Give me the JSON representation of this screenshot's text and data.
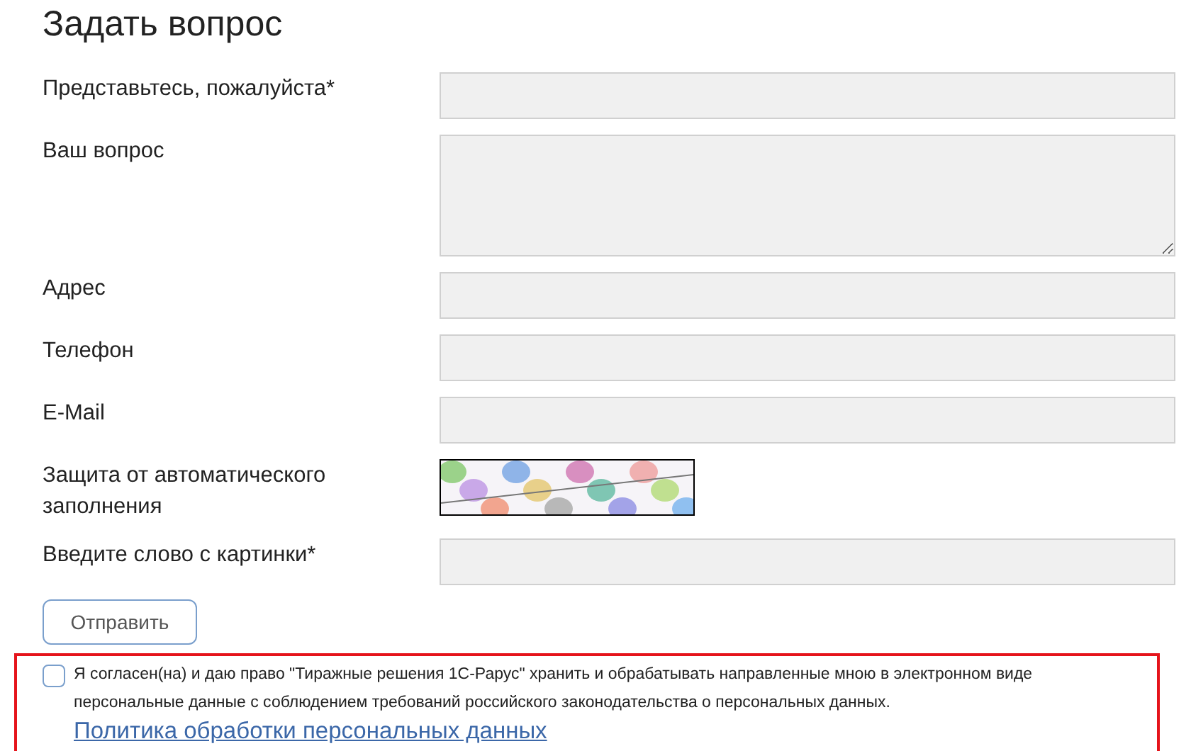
{
  "title": "Задать вопрос",
  "fields": [
    {
      "kind": "input",
      "label": "Представьтесь, пожалуйста*"
    },
    {
      "kind": "textarea",
      "label": "Ваш вопрос"
    },
    {
      "kind": "input",
      "label": "Адрес"
    },
    {
      "kind": "input",
      "label": "Телефон"
    },
    {
      "kind": "input",
      "label": "E-Mail"
    },
    {
      "kind": "captcha",
      "label": "Защита от автоматического заполнения"
    },
    {
      "kind": "input",
      "label": "Введите слово с картинки*"
    }
  ],
  "submit": "Отправить",
  "consent": {
    "checked": false,
    "text": "Я согласен(на) и даю право \"Тиражные решения 1С-Рарус\" хранить и обрабатывать направленные мною в электронном виде персональные данные с соблюдением требований российского законодательства о персональных данных.",
    "link": "Политика обработки персональных данных"
  }
}
